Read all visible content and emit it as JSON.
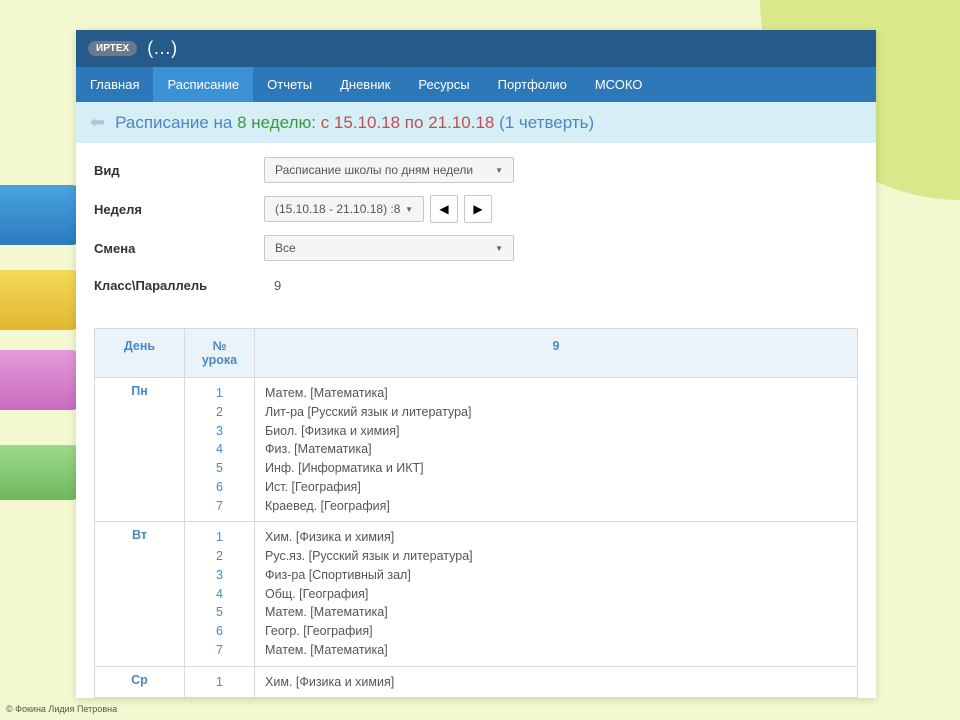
{
  "logo": "ИРТЕХ",
  "app_title_suffix": "(…)",
  "nav": {
    "items": [
      "Главная",
      "Расписание",
      "Отчеты",
      "Дневник",
      "Ресурсы",
      "Портфолио",
      "МСОКО"
    ],
    "active_index": 1
  },
  "title": {
    "prefix": "Расписание на ",
    "week": "8 неделю: ",
    "daterange": "с 15.10.18 по 21.10.18 ",
    "quarter": "(1 четверть)"
  },
  "filters": {
    "view_label": "Вид",
    "view_value": "Расписание школы по дням недели",
    "week_label": "Неделя",
    "week_value": "(15.10.18 - 21.10.18) :8",
    "shift_label": "Смена",
    "shift_value": "Все",
    "class_label": "Класс\\Параллель",
    "class_value": "9"
  },
  "table": {
    "headers": {
      "day": "День",
      "lesson_no": "№ урока",
      "class": "9"
    },
    "days": [
      {
        "name": "Пн",
        "lessons": [
          {
            "n": "1",
            "subj": "Матем. [Математика]"
          },
          {
            "n": "2",
            "subj": "Лит-ра [Русский язык и литература]"
          },
          {
            "n": "3",
            "subj": "Биол. [Физика и химия]"
          },
          {
            "n": "4",
            "subj": "Физ. [Математика]"
          },
          {
            "n": "5",
            "subj": "Инф. [Информатика и ИКТ]"
          },
          {
            "n": "6",
            "subj": "Ист. [География]"
          },
          {
            "n": "7",
            "subj": "Краевед. [География]"
          }
        ]
      },
      {
        "name": "Вт",
        "lessons": [
          {
            "n": "1",
            "subj": "Хим. [Физика и химия]"
          },
          {
            "n": "2",
            "subj": "Рус.яз. [Русский язык и литература]"
          },
          {
            "n": "3",
            "subj": "Физ-ра [Спортивный зал]"
          },
          {
            "n": "4",
            "subj": "Общ. [География]"
          },
          {
            "n": "5",
            "subj": "Матем. [Математика]"
          },
          {
            "n": "6",
            "subj": "Геогр. [География]"
          },
          {
            "n": "7",
            "subj": "Матем. [Математика]"
          }
        ]
      },
      {
        "name": "Ср",
        "lessons": [
          {
            "n": "1",
            "subj": "Хим. [Физика и химия]"
          }
        ]
      }
    ]
  },
  "footer_credit": "© Фокина Лидия Петровна"
}
